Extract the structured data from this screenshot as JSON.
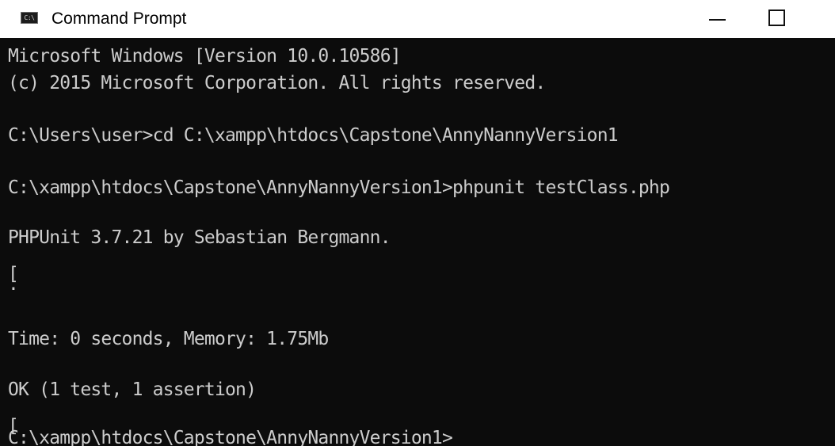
{
  "window": {
    "title": "Command Prompt",
    "icon": "cmd-icon",
    "icon_text": "C:\\",
    "minimize_icon": "minimize-icon",
    "maximize_icon": "maximize-icon"
  },
  "console": {
    "background": "#0c0c0c",
    "text_color": "#cccccc",
    "lines": [
      "Microsoft Windows [Version 10.0.10586]",
      "(c) 2015 Microsoft Corporation. All rights reserved.",
      "",
      "C:\\Users\\user>cd C:\\xampp\\htdocs\\Capstone\\AnnyNannyVersion1",
      "",
      "C:\\xampp\\htdocs\\Capstone\\AnnyNannyVersion1>phpunit testClass.php",
      "",
      "PHPUnit 3.7.21 by Sebastian Bergmann.",
      "",
      "[",
      ".",
      "",
      "Time: 0 seconds, Memory: 1.75Mb",
      "",
      "OK (1 test, 1 assertion)",
      "",
      "[",
      "C:\\xampp\\htdocs\\Capstone\\AnnyNannyVersion1>"
    ]
  }
}
